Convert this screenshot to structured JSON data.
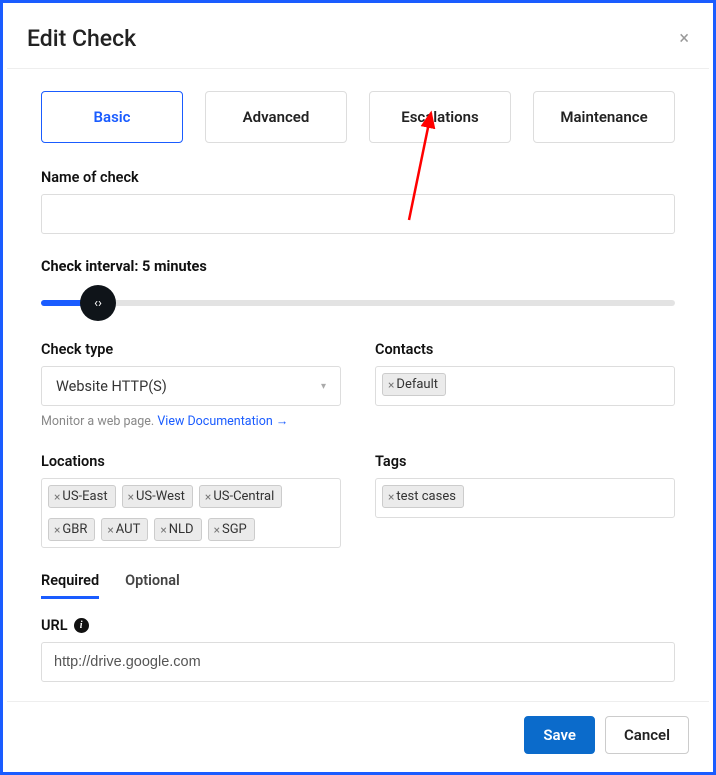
{
  "modal": {
    "title": "Edit Check",
    "close_icon": "×"
  },
  "tabs": {
    "items": [
      {
        "label": "Basic"
      },
      {
        "label": "Advanced"
      },
      {
        "label": "Escalations"
      },
      {
        "label": "Maintenance"
      }
    ],
    "active_index": 0
  },
  "name_of_check": {
    "label": "Name of check",
    "value": ""
  },
  "interval": {
    "label_prefix": "Check interval: ",
    "value_text": "5 minutes",
    "slider_percent": 9
  },
  "check_type": {
    "label": "Check type",
    "selected": "Website HTTP(S)",
    "hint_text": "Monitor a web page. ",
    "hint_link": "View Documentation →"
  },
  "contacts": {
    "label": "Contacts",
    "chips": [
      "Default"
    ]
  },
  "locations": {
    "label": "Locations",
    "chips": [
      "US-East",
      "US-West",
      "US-Central",
      "GBR",
      "AUT",
      "NLD",
      "SGP"
    ]
  },
  "tags": {
    "label": "Tags",
    "chips": [
      "test cases"
    ]
  },
  "subtabs": {
    "items": [
      {
        "label": "Required"
      },
      {
        "label": "Optional"
      }
    ],
    "active_index": 0
  },
  "url": {
    "label": "URL",
    "value": "http://drive.google.com"
  },
  "footer": {
    "save": "Save",
    "cancel": "Cancel"
  },
  "annotation": {
    "arrow_color": "#ff0000"
  }
}
